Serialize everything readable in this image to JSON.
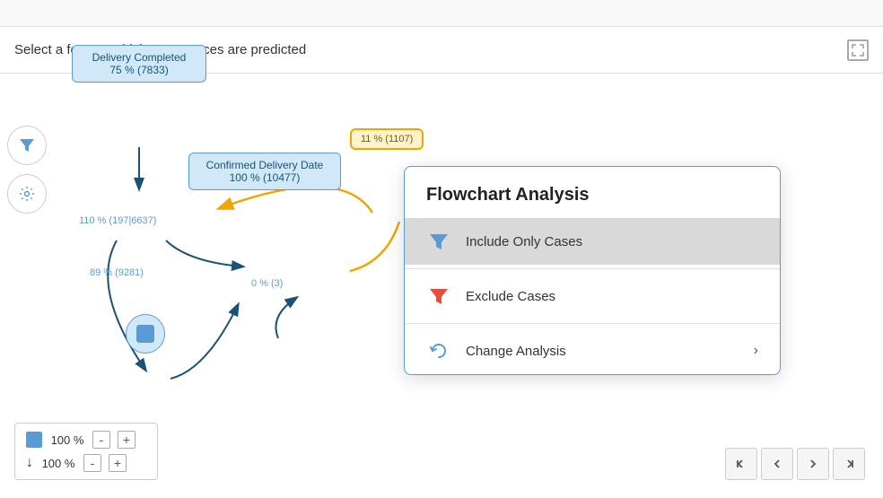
{
  "feature_bar": {
    "text": "Select a feature which occurrences are predicted"
  },
  "nodes": {
    "delivery_completed": {
      "label": "Delivery Completed",
      "stats": "75 % (7833)"
    },
    "confirmed_delivery": {
      "label": "Confirmed Delivery Date",
      "stats": "100 % (10477)"
    },
    "highlight_node": {
      "label": "11 % (1107)"
    }
  },
  "edge_labels": {
    "e1": "110 % (197|6637)",
    "e2": "89 % (9281)",
    "e3": "0 % (3)"
  },
  "legend": {
    "box_pct": "100 %",
    "arrow_pct": "100 %",
    "minus_label": "-",
    "plus_label": "+"
  },
  "context_menu": {
    "title": "Flowchart Analysis",
    "items": [
      {
        "id": "include-only-cases",
        "icon": "filter",
        "icon_color": "blue",
        "label": "Include Only Cases",
        "active": true
      },
      {
        "id": "exclude-cases",
        "icon": "filter",
        "icon_color": "red",
        "label": "Exclude Cases",
        "active": false
      },
      {
        "id": "change-analysis",
        "icon": "refresh",
        "icon_color": "blue",
        "label": "Change Analysis",
        "has_chevron": true,
        "active": false
      }
    ]
  },
  "nav_buttons": {
    "prev_prev": "⟨⟨",
    "prev": "⟨",
    "next": "⟩",
    "next_next": "⟩⟩"
  }
}
